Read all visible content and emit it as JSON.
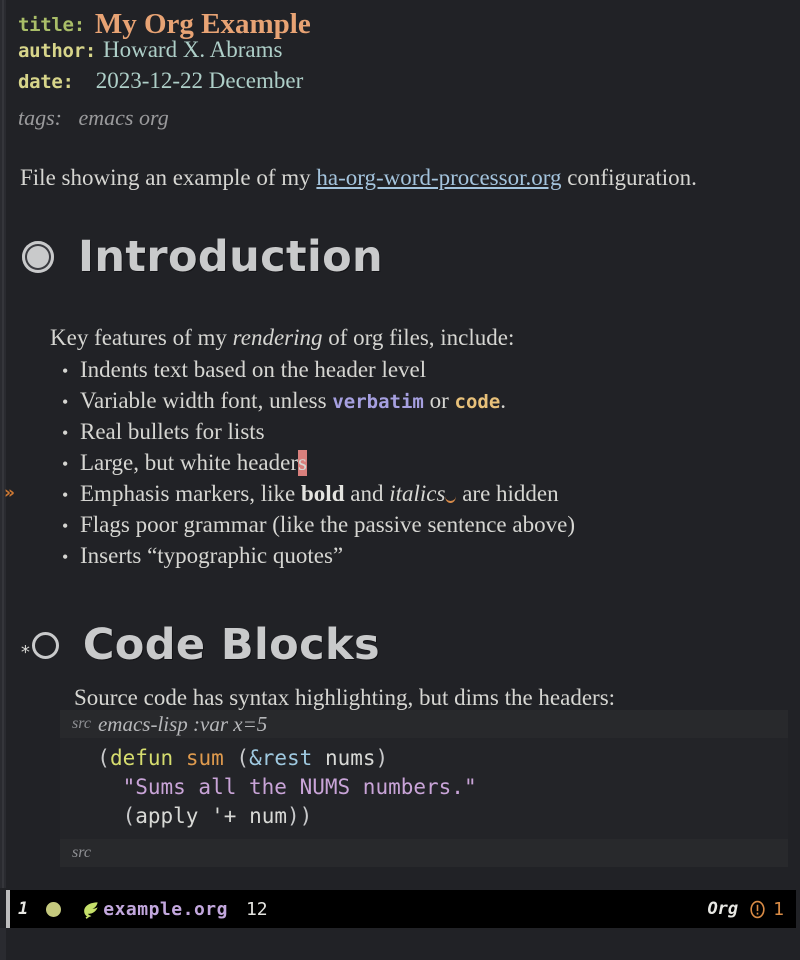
{
  "window": {
    "background": "#212226",
    "foreground": "#d6d6d2"
  },
  "keywords": {
    "title": {
      "key": "title:",
      "value": "My Org Example",
      "key_color": "#a9bd68",
      "value_color": "#e8a374"
    },
    "author": {
      "key": "author:",
      "value": "Howard X. Abrams",
      "key_color": "#d7d58a",
      "value_color": "#aecfc8"
    },
    "date": {
      "key": "date:",
      "value": "2023-12-22 December",
      "key_color": "#d7d58a",
      "value_color": "#aecfc8"
    },
    "tags": {
      "key": "tags:",
      "value": "emacs org",
      "color": "#9a9a9c"
    }
  },
  "intro_paragraph": {
    "before_link": "File showing an example of my ",
    "link": "ha-org-word-processor.org",
    "after_link": " configuration.",
    "link_color": "#a4c4dd"
  },
  "sections": [
    {
      "id": "introduction",
      "heading": "Introduction",
      "bullet_icon": "filled-ring-bullet-icon",
      "lead_before": "Key features of my ",
      "lead_italic": "rendering",
      "lead_after": " of org files, include:",
      "items": [
        {
          "text": "Indents text based on the header level"
        },
        {
          "prefix": "Variable width font, unless ",
          "verbatim": "verbatim",
          "middle": " or ",
          "code": "code",
          "suffix": "."
        },
        {
          "text": "Real bullets for lists"
        },
        {
          "prefix": "Large, but white header",
          "cursor_char": "s"
        },
        {
          "prefix": "Emphasis markers, like ",
          "bold": "bold",
          "middle": " and ",
          "italic": "italics",
          "suffix": " are hidden"
        },
        {
          "text": "Flags poor grammar (like the passive sentence above)"
        },
        {
          "text": "Inserts “typographic quotes”"
        }
      ]
    },
    {
      "id": "code-blocks",
      "heading": "Code Blocks",
      "bullet_icon": "open-ring-bullet-icon",
      "heading_star": "*",
      "lead": "Source code has syntax highlighting, but dims the headers:"
    }
  ],
  "src_block": {
    "begin_tag": "src",
    "begin_args": "emacs-lisp :var x=5",
    "end_tag": "src",
    "language": "emacs-lisp",
    "lines": [
      {
        "indent": "  ",
        "tokens": [
          {
            "t": "(",
            "c": "paren"
          },
          {
            "t": "defun",
            "c": "keyword"
          },
          {
            "t": " ",
            "c": "var"
          },
          {
            "t": "sum",
            "c": "fn"
          },
          {
            "t": " ",
            "c": "var"
          },
          {
            "t": "(",
            "c": "paren"
          },
          {
            "t": "&rest",
            "c": "arg"
          },
          {
            "t": " ",
            "c": "var"
          },
          {
            "t": "nums",
            "c": "var"
          },
          {
            "t": ")",
            "c": "paren"
          }
        ]
      },
      {
        "indent": "    ",
        "tokens": [
          {
            "t": "\"Sums all the NUMS numbers.\"",
            "c": "string"
          }
        ]
      },
      {
        "indent": "    ",
        "tokens": [
          {
            "t": "(",
            "c": "paren"
          },
          {
            "t": "apply",
            "c": "var"
          },
          {
            "t": " ",
            "c": "var"
          },
          {
            "t": "'+",
            "c": "var"
          },
          {
            "t": " ",
            "c": "var"
          },
          {
            "t": "num",
            "c": "var"
          },
          {
            "t": "))",
            "c": "paren"
          }
        ]
      }
    ]
  },
  "fringe": {
    "marker": "»",
    "marker_color": "#cc7833"
  },
  "modeline": {
    "window_number": "1",
    "modified_indicator_color": "#c5c97e",
    "buffer_icon": "org-leaf-icon",
    "buffer_name": "example.org",
    "position": "12",
    "major_mode": "Org",
    "warning_icon": "exclamation-circle-icon",
    "warning_count": "1",
    "warning_color": "#d98b45",
    "background": "#000000"
  }
}
